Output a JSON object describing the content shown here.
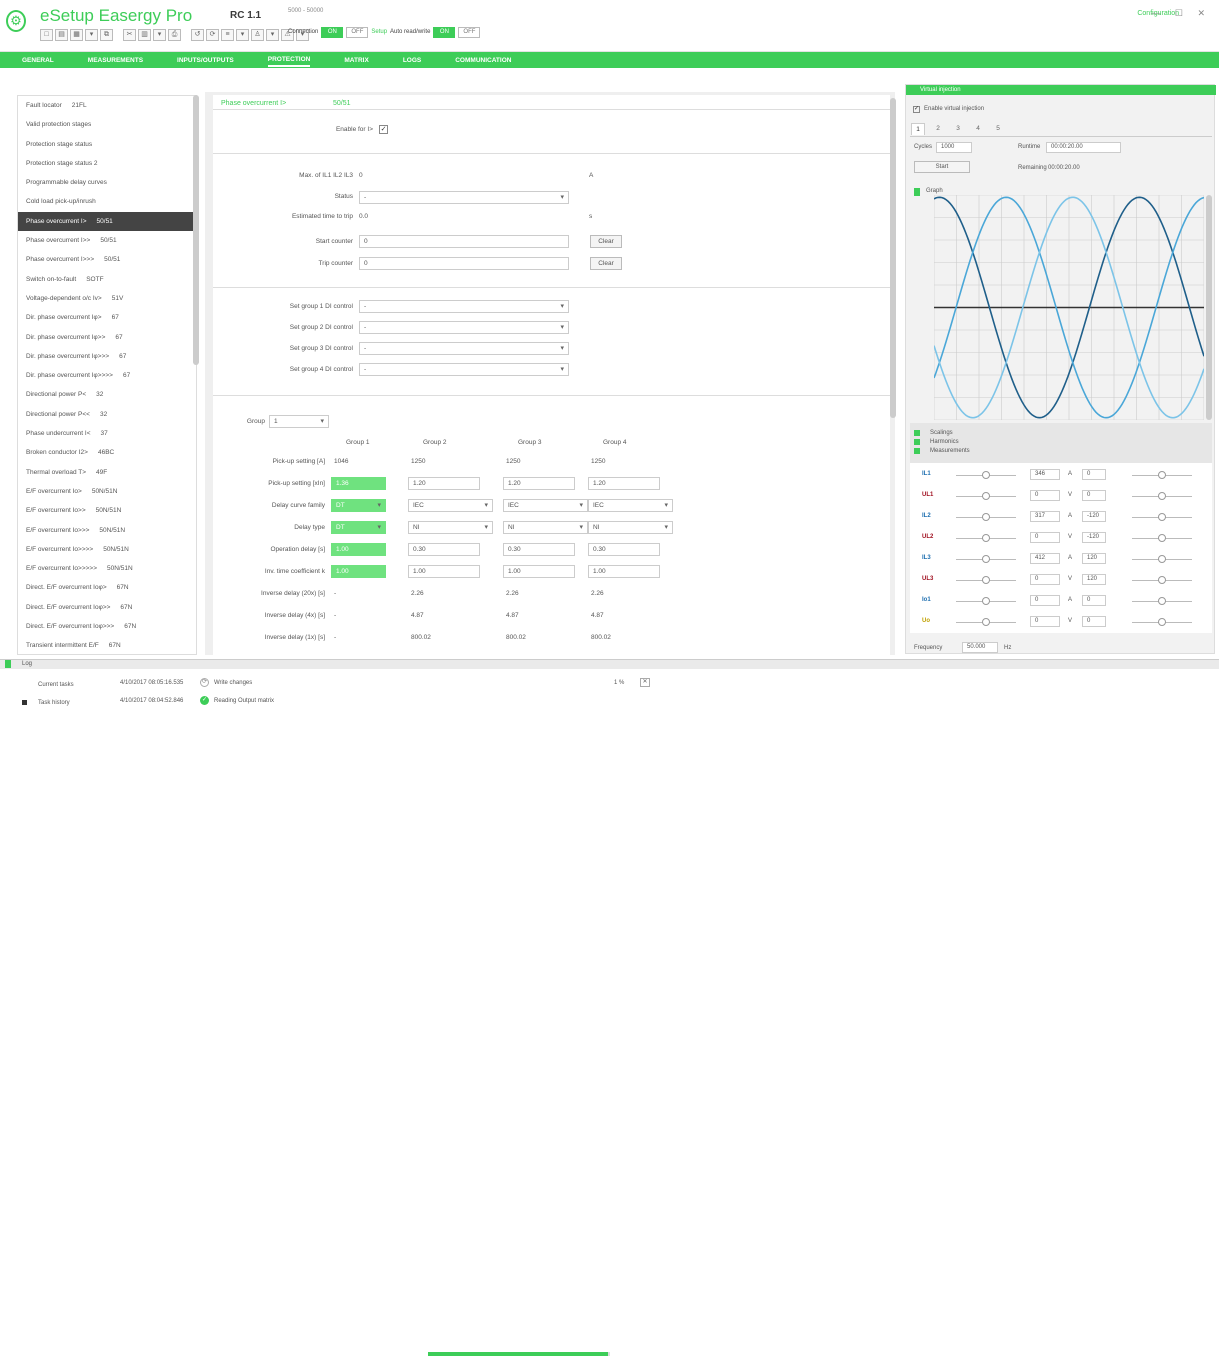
{
  "app": {
    "title": "eSetup Easergy Pro",
    "device": "RC 1.1",
    "device_sub": "5000 - 50000",
    "configuration": "Configuration",
    "win_controls": "— ☐ ✕"
  },
  "connection": {
    "label": "Connection",
    "on": "ON",
    "off": "OFF",
    "setup_label": "Setup",
    "auto_label": "Auto read/write",
    "auto_on": "ON",
    "auto_off": "OFF"
  },
  "tabs": [
    "GENERAL",
    "MEASUREMENTS",
    "INPUTS/OUTPUTS",
    "PROTECTION",
    "MATRIX",
    "LOGS",
    "COMMUNICATION"
  ],
  "active_tab": "PROTECTION",
  "left_items": [
    {
      "name": "Fault locator",
      "code": "21FL"
    },
    {
      "name": "Valid protection stages",
      "code": ""
    },
    {
      "name": "Protection stage status",
      "code": ""
    },
    {
      "name": "Protection stage status 2",
      "code": ""
    },
    {
      "name": "Programmable delay curves",
      "code": ""
    },
    {
      "name": "Cold load pick-up/inrush",
      "code": ""
    },
    {
      "name": "Phase overcurrent I>",
      "code": "50/51",
      "selected": true
    },
    {
      "name": "Phase overcurrent I>>",
      "code": "50/51"
    },
    {
      "name": "Phase overcurrent I>>>",
      "code": "50/51"
    },
    {
      "name": "Switch on-to-fault",
      "code": "SOTF"
    },
    {
      "name": "Voltage-dependent o/c Iv>",
      "code": "51V"
    },
    {
      "name": "Dir. phase overcurrent Iφ>",
      "code": "67"
    },
    {
      "name": "Dir. phase overcurrent Iφ>>",
      "code": "67"
    },
    {
      "name": "Dir. phase overcurrent Iφ>>>",
      "code": "67"
    },
    {
      "name": "Dir. phase overcurrent Iφ>>>>",
      "code": "67"
    },
    {
      "name": "Directional power P<",
      "code": "32"
    },
    {
      "name": "Directional power P<<",
      "code": "32"
    },
    {
      "name": "Phase undercurrent I<",
      "code": "37"
    },
    {
      "name": "Broken conductor I2>",
      "code": "46BC"
    },
    {
      "name": "Thermal overload T>",
      "code": "49F"
    },
    {
      "name": "E/F overcurrent Io>",
      "code": "50N/51N"
    },
    {
      "name": "E/F overcurrent Io>>",
      "code": "50N/51N"
    },
    {
      "name": "E/F overcurrent Io>>>",
      "code": "50N/51N"
    },
    {
      "name": "E/F overcurrent Io>>>>",
      "code": "50N/51N"
    },
    {
      "name": "E/F overcurrent Io>>>>>",
      "code": "50N/51N"
    },
    {
      "name": "Direct. E/F overcurrent Ioφ>",
      "code": "67N"
    },
    {
      "name": "Direct. E/F overcurrent Ioφ>>",
      "code": "67N"
    },
    {
      "name": "Direct. E/F overcurrent Ioφ>>>",
      "code": "67N"
    },
    {
      "name": "Transient intermittent E/F",
      "code": "67N"
    }
  ],
  "panel": {
    "title": "Phase overcurrent I>",
    "code": "50/51",
    "enable_label": "Enable for I>",
    "enable_checked": "✓",
    "max_label": "Max. of IL1 IL2 IL3",
    "max_value": "0",
    "max_unit": "A",
    "status_label": "Status",
    "status_value": "-",
    "est_label": "Estimated time to trip",
    "est_value": "0.0",
    "est_unit": "s",
    "start_label": "Start counter",
    "start_value": "0",
    "trip_label": "Trip counter",
    "trip_value": "0",
    "clear": "Clear",
    "set_groups": [
      {
        "label": "Set group 1 DI control",
        "value": "-"
      },
      {
        "label": "Set group 2 DI control",
        "value": "-"
      },
      {
        "label": "Set group 3 DI control",
        "value": "-"
      },
      {
        "label": "Set group 4 DI control",
        "value": "-"
      }
    ],
    "group_label": "Group",
    "group_value": "1",
    "group_headers": [
      "Group 1",
      "Group 2",
      "Group 3",
      "Group 4"
    ],
    "rows": [
      {
        "label": "Pick-up setting [A]",
        "values": [
          "1046",
          "1250",
          "1250",
          "1250"
        ],
        "type": "text"
      },
      {
        "label": "Pick-up setting [xIn]",
        "values": [
          "1.36",
          "1.20",
          "1.20",
          "1.20"
        ],
        "type": "input"
      },
      {
        "label": "Delay curve family",
        "values": [
          "DT",
          "IEC",
          "IEC",
          "IEC"
        ],
        "type": "select"
      },
      {
        "label": "Delay type",
        "values": [
          "DT",
          "NI",
          "NI",
          "NI"
        ],
        "type": "select"
      },
      {
        "label": "Operation delay [s]",
        "values": [
          "1.00",
          "0.30",
          "0.30",
          "0.30"
        ],
        "type": "input"
      },
      {
        "label": "Inv. time coefficient k",
        "values": [
          "1.00",
          "1.00",
          "1.00",
          "1.00"
        ],
        "type": "input"
      },
      {
        "label": "Inverse delay (20x) [s]",
        "values": [
          "-",
          "2.26",
          "2.26",
          "2.26"
        ],
        "type": "text"
      },
      {
        "label": "Inverse delay (4x) [s]",
        "values": [
          "-",
          "4.87",
          "4.87",
          "4.87"
        ],
        "type": "text"
      },
      {
        "label": "Inverse delay (1x) [s]",
        "values": [
          "-",
          "800.02",
          "800.02",
          "800.02"
        ],
        "type": "text"
      }
    ]
  },
  "vi": {
    "header": "Virtual injection",
    "enable_label": "Enable virtual injection",
    "tabs": [
      "1",
      "2",
      "3",
      "4",
      "5"
    ],
    "cycles_label": "Cycles",
    "cycles_value": "1000",
    "runtime_label": "Runtime",
    "runtime_value": "00:00:20.00",
    "start": "Start",
    "remaining_label": "Remaining",
    "remaining_value": "00:00:20.00",
    "graph_label": "Graph",
    "sections": [
      "Scalings",
      "Harmonics",
      "Measurements"
    ],
    "meas": [
      {
        "label": "IL1",
        "color": "#1f6fb0",
        "val1": "346",
        "unit1": "A",
        "val2": "0"
      },
      {
        "label": "UL1",
        "color": "#a01020",
        "val1": "0",
        "unit1": "V",
        "val2": "0"
      },
      {
        "label": "IL2",
        "color": "#1f6fb0",
        "val1": "317",
        "unit1": "A",
        "val2": "-120"
      },
      {
        "label": "UL2",
        "color": "#a01020",
        "val1": "0",
        "unit1": "V",
        "val2": "-120"
      },
      {
        "label": "IL3",
        "color": "#1f6fb0",
        "val1": "412",
        "unit1": "A",
        "val2": "120"
      },
      {
        "label": "UL3",
        "color": "#a01020",
        "val1": "0",
        "unit1": "V",
        "val2": "120"
      },
      {
        "label": "Io1",
        "color": "#1f6fb0",
        "val1": "0",
        "unit1": "A",
        "val2": "0"
      },
      {
        "label": "Uo",
        "color": "#c0a000",
        "val1": "0",
        "unit1": "V",
        "val2": "0"
      }
    ],
    "frequency_label": "Frequency",
    "frequency_value": "50.000",
    "frequency_unit": "Hz"
  },
  "log": {
    "title": "Log",
    "current_tasks": "Current tasks",
    "task_history": "Task history",
    "entry1_time": "4/10/2017 08:05:16.535",
    "entry1_text": "Write changes",
    "entry2_time": "4/10/2017 08:04:52.846",
    "entry2_text": "Reading Output matrix",
    "progress_text": "1 %",
    "progress": 0.99
  }
}
